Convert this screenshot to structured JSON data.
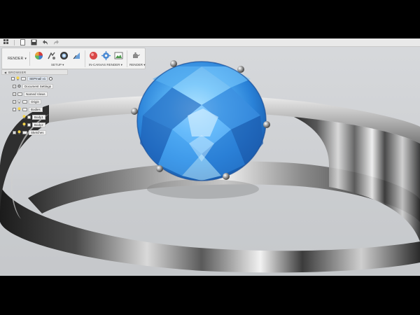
{
  "quick_access": {
    "icons": [
      "grid-icon",
      "file-icon",
      "save-icon",
      "undo-icon",
      "redo-icon"
    ]
  },
  "toolbar": {
    "workspace_label": "RENDER",
    "groups": [
      {
        "label": "SETUP ▾"
      },
      {
        "label": "IN-CANVAS RENDER ▾"
      },
      {
        "label": "RENDER ▾"
      }
    ]
  },
  "browser": {
    "title": "BROWSER",
    "items": [
      {
        "label": "SEPmail v1"
      },
      {
        "label": "Document Settings"
      },
      {
        "label": "Named Views"
      },
      {
        "label": "Origin"
      },
      {
        "label": "Bodies"
      },
      {
        "label": "Body1"
      },
      {
        "label": "Body2"
      },
      {
        "label": "Sketches"
      }
    ]
  },
  "colors": {
    "gem": "#2f8fe6",
    "gem_light": "#8fd2ff",
    "metal_dark": "#2a2a2a",
    "metal_light": "#e8e8e8",
    "background": "#d3d5d8"
  }
}
